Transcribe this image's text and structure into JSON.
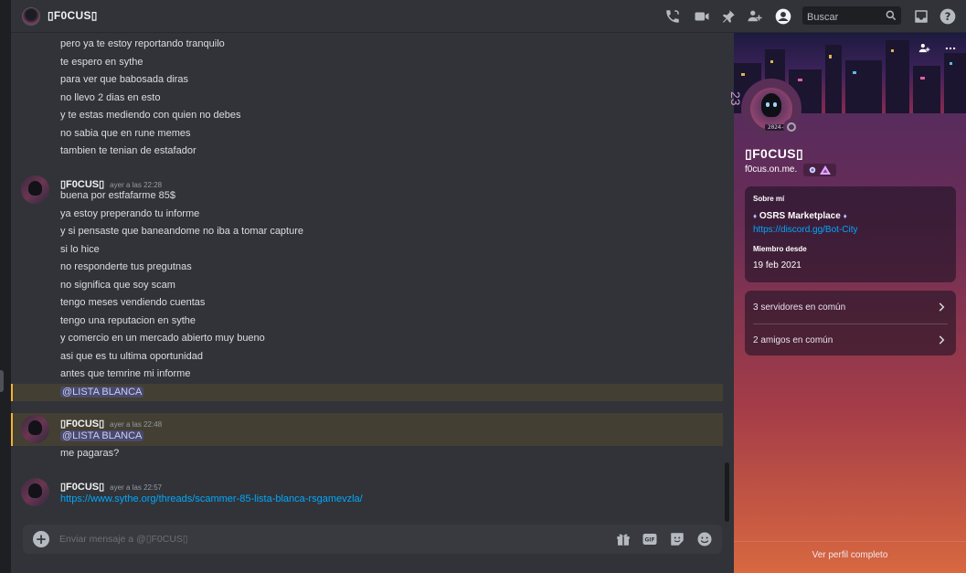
{
  "header": {
    "title": "▯F0CUS▯",
    "search_placeholder": "Buscar",
    "icons": [
      "call-icon",
      "video-icon",
      "pin-icon",
      "add-friends-icon",
      "profile-toggle-icon",
      "search-icon",
      "inbox-icon",
      "help-icon"
    ]
  },
  "chat": {
    "earlier_lines": [
      "pero ya te estoy reportando tranquilo",
      "te espero en sythe",
      "para ver que babosada diras",
      "no llevo 2 dias en esto",
      "y te estas mediendo con quien no debes",
      "no sabia que en rune memes",
      "tambien te tenian de estafador"
    ],
    "groups": [
      {
        "author": "▯F0CUS▯",
        "timestamp": "ayer a las 22:28",
        "lines": [
          "buena por estfafarme 85$",
          "ya estoy preperando tu informe",
          "y si pensaste que baneandome no iba a tomar capture",
          "si lo hice",
          "no responderte tus pregutnas",
          "no significa que soy scam",
          "tengo meses vendiendo cuentas",
          "tengo una reputacion en sythe",
          "y comercio en un mercado abierto muy bueno",
          "asi que es tu ultima oportunidad",
          "antes que temrine mi informe"
        ],
        "mention": "@LISTA BLANCA"
      },
      {
        "author": "▯F0CUS▯",
        "timestamp": "ayer a las 22:48",
        "mention": "@LISTA BLANCA",
        "lines": [
          "me pagaras?"
        ]
      },
      {
        "author": "▯F0CUS▯",
        "timestamp": "ayer a las 22:57",
        "link": "https://www.sythe.org/threads/scammer-85-lista-blanca-rsgamevzla/"
      }
    ]
  },
  "composer": {
    "placeholder": "Enviar mensaje a @▯F0CUS▯",
    "icons": [
      "add-attachment-icon",
      "gift-icon",
      "gif-icon",
      "sticker-icon",
      "emoji-icon"
    ]
  },
  "profile": {
    "display_name": "▯F0CUS▯",
    "username": "f0cus.on.me.",
    "avatar_badge_number": "23",
    "avatar_tag": "2024-1",
    "about_label": "Sobre mí",
    "about_title": "OSRS Marketplace",
    "about_link": "https://discord.gg/Bot-City",
    "member_since_label": "Miembro desde",
    "member_since": "19 feb 2021",
    "mutual_servers": "3 servidores en común",
    "mutual_friends": "2 amigos en común",
    "full_profile": "Ver perfil completo"
  },
  "colors": {
    "background": "#313338",
    "mention_bg": "#3c4270",
    "highlight_border": "#f0b232",
    "link": "#00a8fc"
  }
}
